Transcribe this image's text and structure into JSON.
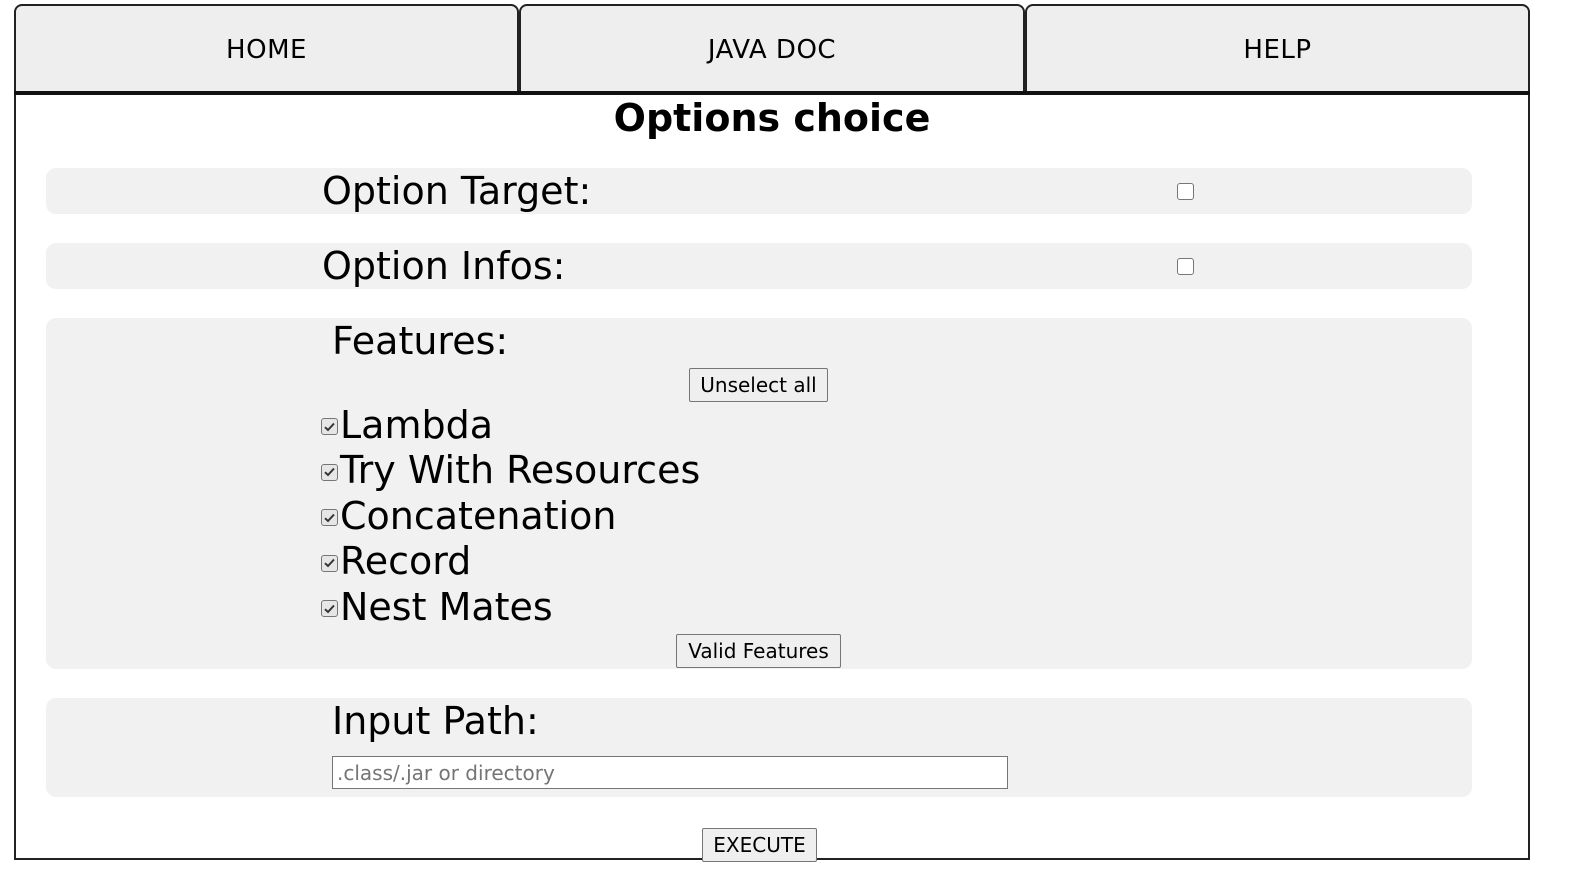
{
  "tabs": [
    {
      "label": "HOME"
    },
    {
      "label": "JAVA DOC"
    },
    {
      "label": "HELP"
    }
  ],
  "page_title": "Options choice",
  "options": {
    "target_label": "Option Target:",
    "target_checked": false,
    "infos_label": "Option Infos:",
    "infos_checked": false
  },
  "features": {
    "label": "Features:",
    "unselect_all_label": "Unselect all",
    "items": [
      {
        "label": "Lambda",
        "checked": true
      },
      {
        "label": "Try With Resources",
        "checked": true
      },
      {
        "label": "Concatenation",
        "checked": true
      },
      {
        "label": "Record",
        "checked": true
      },
      {
        "label": "Nest Mates",
        "checked": true
      }
    ],
    "valid_label": "Valid Features"
  },
  "input_path": {
    "label": "Input Path:",
    "placeholder": ".class/.jar or directory",
    "value": ""
  },
  "execute_label": "EXECUTE"
}
